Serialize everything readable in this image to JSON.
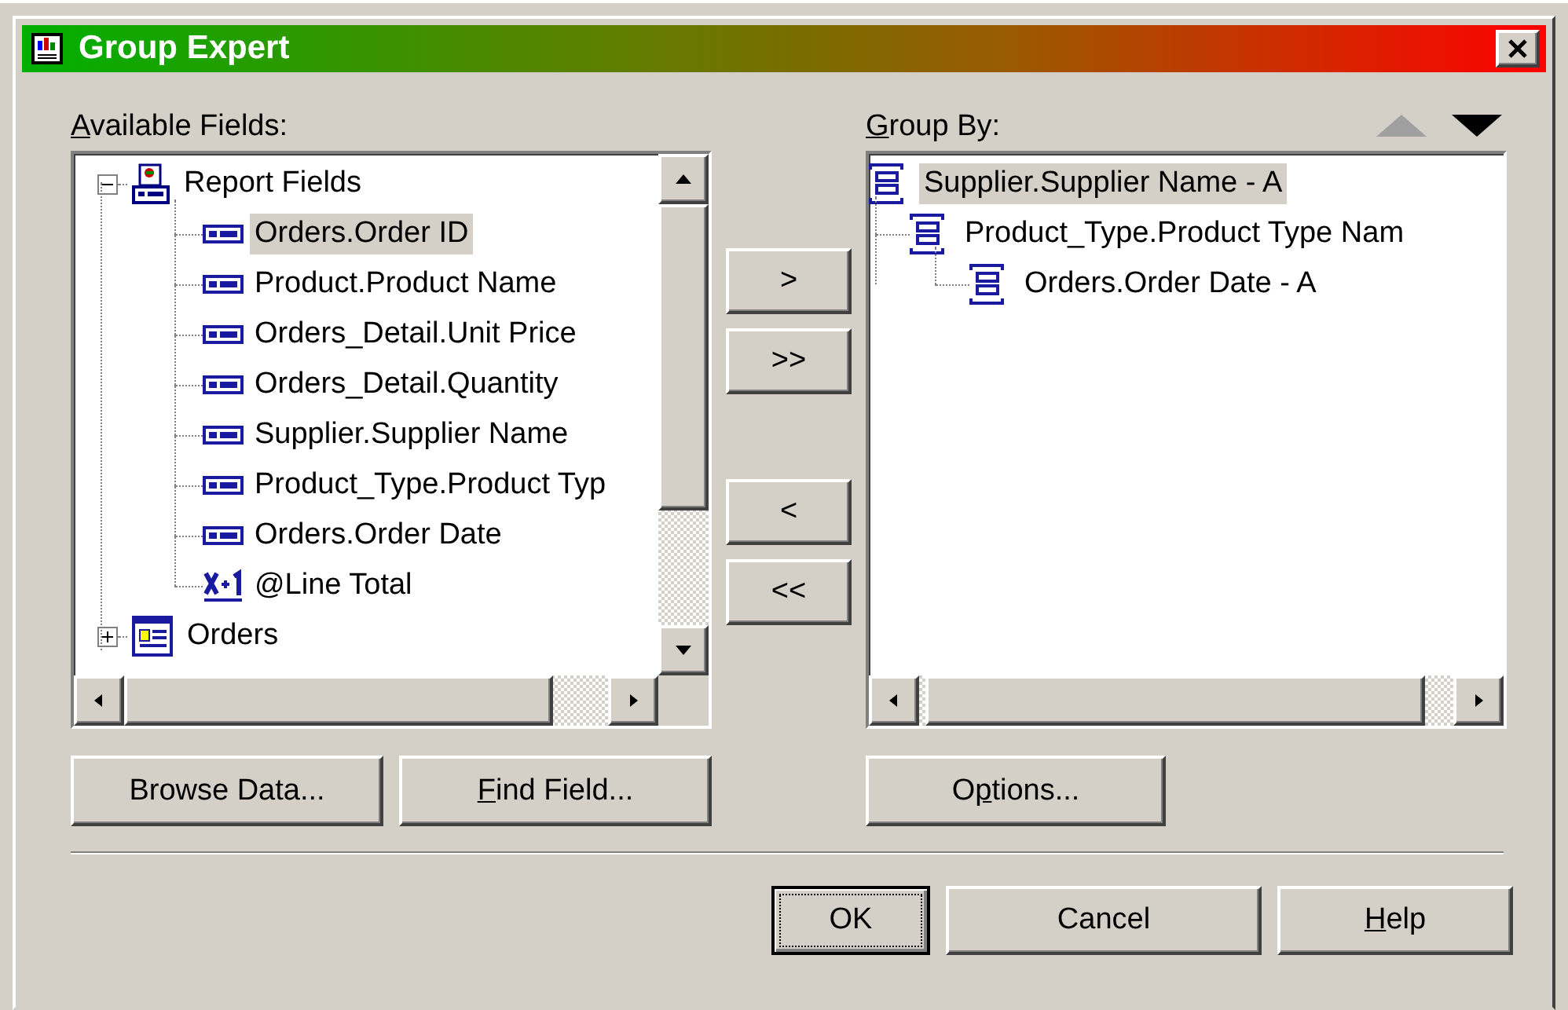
{
  "window": {
    "title": "Group Expert"
  },
  "available_fields": {
    "label": {
      "key": "A",
      "post": "vailable Fields:"
    },
    "tree": [
      {
        "label": "Report Fields",
        "kind": "report",
        "expanded": true,
        "selected": false,
        "children": [
          {
            "label": "Orders.Order ID",
            "kind": "field",
            "selected": true
          },
          {
            "label": "Product.Product Name",
            "kind": "field",
            "selected": false
          },
          {
            "label": "Orders_Detail.Unit Price",
            "kind": "field",
            "selected": false
          },
          {
            "label": "Orders_Detail.Quantity",
            "kind": "field",
            "selected": false
          },
          {
            "label": "Supplier.Supplier Name",
            "kind": "field",
            "selected": false
          },
          {
            "label": "Product_Type.Product Typ",
            "kind": "field",
            "selected": false
          },
          {
            "label": "Orders.Order Date",
            "kind": "field",
            "selected": false
          },
          {
            "label": "@Line Total",
            "kind": "formula",
            "selected": false
          }
        ]
      },
      {
        "label": "Orders",
        "kind": "table",
        "expanded": false,
        "selected": false
      }
    ]
  },
  "move_buttons": [
    ">",
    ">>",
    "<",
    "<<"
  ],
  "group_by": {
    "label": {
      "key": "G",
      "post": "roup By:"
    },
    "move_up": {
      "disabled": true
    },
    "move_down": {
      "disabled": false
    },
    "tree": [
      {
        "label": "Supplier.Supplier Name - A",
        "selected": true,
        "children": [
          {
            "label": "Product_Type.Product Type Nam",
            "selected": false,
            "children": [
              {
                "label": "Orders.Order Date - A",
                "selected": false
              }
            ]
          }
        ]
      }
    ]
  },
  "field_buttons": [
    {
      "pre": "Browse Data..."
    },
    {
      "key": "F",
      "post": "ind Field..."
    }
  ],
  "options_button": {
    "pre": "O",
    "key": "p",
    "post": "tions..."
  },
  "dialog_buttons": [
    {
      "pre": "OK",
      "default": true
    },
    {
      "pre": "Cancel",
      "default": false
    },
    {
      "key": "H",
      "post": "elp",
      "default": false
    }
  ]
}
